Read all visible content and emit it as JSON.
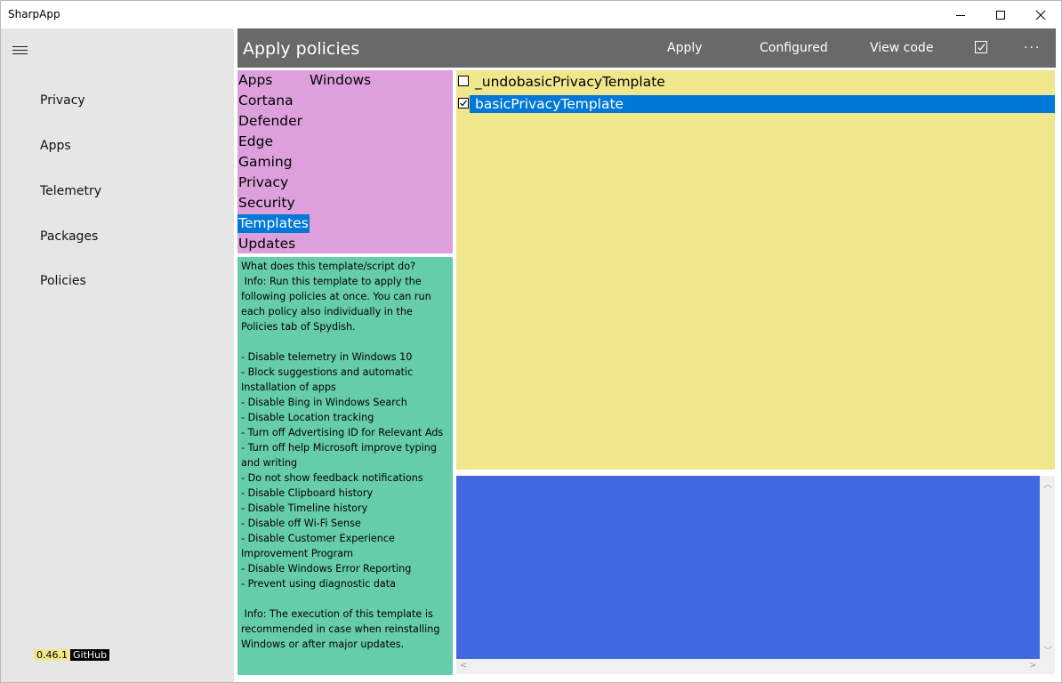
{
  "window": {
    "title": "SharpApp"
  },
  "sidebar": {
    "items": [
      {
        "label": "Privacy"
      },
      {
        "label": "Apps"
      },
      {
        "label": "Telemetry"
      },
      {
        "label": "Packages"
      },
      {
        "label": "Policies"
      }
    ],
    "version": "0.46.1",
    "github": "GitHub"
  },
  "header": {
    "title": "Apply policies",
    "apply_label": "Apply",
    "configured_label": "Configured",
    "view_code_label": "View code",
    "more_label": "..."
  },
  "categories": [
    {
      "label": "Apps"
    },
    {
      "label": "Windows"
    },
    {
      "label": "Cortana"
    },
    {
      "label": "Defender"
    },
    {
      "label": "Edge"
    },
    {
      "label": "Gaming"
    },
    {
      "label": "Privacy"
    },
    {
      "label": "Security"
    },
    {
      "label": "Templates",
      "selected": true
    },
    {
      "label": "Updates"
    }
  ],
  "info_text": "What does this template/script do?\n Info: Run this template to apply the following policies at once. You can run each policy also individually in the Policies tab of Spydish.\n\n- Disable telemetry in Windows 10\n- Block suggestions and automatic Installation of apps\n- Disable Bing in Windows Search\n- Disable Location tracking\n- Turn off Advertising ID for Relevant Ads\n- Turn off help Microsoft improve typing and writing\n- Do not show feedback notifications\n- Disable Clipboard history\n- Disable Timeline history\n- Disable off Wi-Fi Sense\n- Disable Customer Experience Improvement Program\n- Disable Windows Error Reporting\n- Prevent using diagnostic data\n\n Info: The execution of this template is recommended in case when reinstalling Windows or after major updates.",
  "templates": [
    {
      "label": "_undobasicPrivacyTemplate",
      "checked": false
    },
    {
      "label": "basicPrivacyTemplate",
      "checked": true
    }
  ],
  "colors": {
    "header_bg": "#696969",
    "categories_bg": "#dda0dd",
    "info_bg": "#66cdaa",
    "list_bg": "#f0e68c",
    "output_bg": "#4169e1",
    "selection": "#0078d7",
    "sidebar_bg": "#e6e6e6"
  }
}
